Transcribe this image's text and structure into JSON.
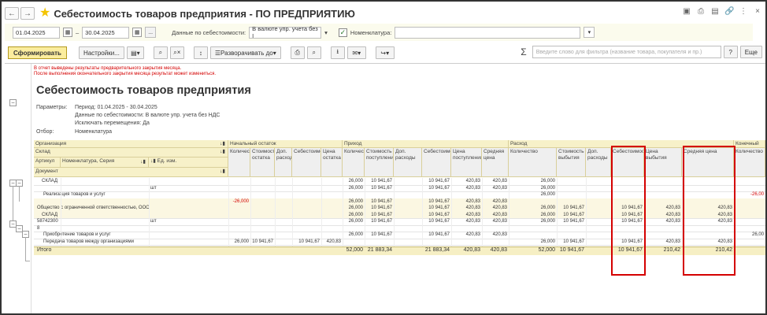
{
  "window": {
    "title": "Себестоимость товаров предприятия - ПО ПРЕДПРИЯТИЮ"
  },
  "params": {
    "date_from": "01.04.2025",
    "date_to": "30.04.2025",
    "dash": "–",
    "ellipsis": "...",
    "cost_data_label": "Данные по себестоимости:",
    "cost_data_value": "В валюте упр. учета без I",
    "nomenclature_label": "Номенклатура:",
    "nomenclature_value": ""
  },
  "toolbar": {
    "generate": "Сформировать",
    "settings": "Настройки...",
    "expand": "Разворачивать до",
    "search_placeholder": "Введите слово для фильтра (название товара, покупателя и пр.)",
    "help": "?",
    "more": "Еще"
  },
  "report": {
    "warning1": "В отчет выведены результаты предварительного закрытия месяца.",
    "warning2": "После выполнения окончательного закрытия месяца результат может измениться.",
    "title": "Себестоимость товаров предприятия",
    "params_label": "Параметры:",
    "period": "Период: 01.04.2025 - 30.04.2025",
    "cost_data": "Данные по себестоимости: В валюте упр. учета без НДС",
    "exclude": "Исключать перемещения: Да",
    "filter_label": "Отбор:",
    "filter_value": "Номенклатура"
  },
  "table": {
    "headers": {
      "org": "Организация",
      "warehouse": "Склад",
      "article": "Артикул",
      "nomenclature": "Номенклатура, Серия",
      "unit": "Ед. изм.",
      "document": "Документ",
      "opening": "Начальный остаток",
      "income": "Приход",
      "expense": "Расход",
      "closing": "Конечный о",
      "o_qty": "Количество",
      "o_cost": "Стоимость остатка",
      "o_add": "Доп. расходы",
      "o_self": "Себестоимость",
      "o_price": "Цена остатка",
      "i_qty": "Количество",
      "i_cost": "Стоимость поступления",
      "i_add": "Доп. расходы",
      "i_self": "Себестоимость",
      "i_price": "Цена поступления",
      "i_avg": "Средняя цена",
      "e_qty": "Количество",
      "e_cost": "Стоимость выбытия",
      "e_add": "Доп. расходы",
      "e_self": "Себестоимость",
      "e_price": "Цена выбытия",
      "e_avg": "Средняя цена",
      "c_qty": "Количество"
    },
    "rows": [
      {
        "label": "СКЛАД",
        "o_qty": "",
        "o_cost": "",
        "o_self": "",
        "o_price": "",
        "i_qty": "26,000",
        "i_cost": "10 941,67",
        "i_self": "10 941,67",
        "i_price": "420,83",
        "i_avg": "420,83",
        "e_qty": "26,000",
        "e_cost": "",
        "e_self": "",
        "e_price": "",
        "e_avg": "",
        "c": ""
      },
      {
        "label": "шт",
        "o_qty": "",
        "o_cost": "",
        "o_self": "",
        "o_price": "",
        "i_qty": "26,000",
        "i_cost": "10 941,67",
        "i_self": "10 941,67",
        "i_price": "420,83",
        "i_avg": "420,83",
        "e_qty": "26,000",
        "e_cost": "",
        "e_self": "",
        "e_price": "",
        "e_avg": "",
        "c": ""
      },
      {
        "label": "Реализация товаров и услуг",
        "o_qty": "",
        "o_cost": "",
        "o_self": "",
        "o_price": "",
        "i_qty": "",
        "i_cost": "",
        "i_self": "",
        "i_price": "",
        "i_avg": "",
        "e_qty": "26,000",
        "e_cost": "",
        "e_self": "",
        "e_price": "",
        "e_avg": "",
        "c": "-26,00"
      },
      {
        "label": "",
        "o_qty": "-26,000",
        "o_cost": "",
        "o_self": "",
        "o_price": "",
        "i_qty": "26,000",
        "i_cost": "10 941,67",
        "i_self": "10 941,67",
        "i_price": "420,83",
        "i_avg": "420,83",
        "e_qty": "",
        "e_cost": "",
        "e_self": "",
        "e_price": "",
        "e_avg": "",
        "c": ""
      },
      {
        "label": "Общество с ограниченной ответственностью, ООО",
        "o_qty": "",
        "o_cost": "",
        "o_self": "",
        "o_price": "",
        "i_qty": "26,000",
        "i_cost": "10 941,67",
        "i_self": "10 941,67",
        "i_price": "420,83",
        "i_avg": "420,83",
        "e_qty": "26,000",
        "e_cost": "10 941,67",
        "e_self": "10 941,67",
        "e_price": "420,83",
        "e_avg": "420,83",
        "c": ""
      },
      {
        "label": "СКЛАД",
        "o_qty": "",
        "o_cost": "",
        "o_self": "",
        "o_price": "",
        "i_qty": "26,000",
        "i_cost": "10 941,67",
        "i_self": "10 941,67",
        "i_price": "420,83",
        "i_avg": "420,83",
        "e_qty": "26,000",
        "e_cost": "10 941,67",
        "e_self": "10 941,67",
        "e_price": "420,83",
        "e_avg": "420,83",
        "c": ""
      },
      {
        "label": "58742300",
        "label2": "шт",
        "o_qty": "",
        "o_cost": "",
        "o_self": "",
        "o_price": "",
        "i_qty": "26,000",
        "i_cost": "10 941,67",
        "i_self": "10 941,67",
        "i_price": "420,83",
        "i_avg": "420,83",
        "e_qty": "26,000",
        "e_cost": "10 941,67",
        "e_self": "10 941,67",
        "e_price": "420,83",
        "e_avg": "420,83",
        "c": ""
      },
      {
        "label": "8",
        "o_qty": "",
        "o_cost": "",
        "o_self": "",
        "o_price": "",
        "i_qty": "",
        "i_cost": "",
        "i_self": "",
        "i_price": "",
        "i_avg": "",
        "e_qty": "",
        "e_cost": "",
        "e_self": "",
        "e_price": "",
        "e_avg": "",
        "c": ""
      },
      {
        "label": "Приобретение товаров и услуг",
        "o_qty": "",
        "o_cost": "",
        "o_self": "",
        "o_price": "",
        "i_qty": "26,000",
        "i_cost": "10 941,67",
        "i_self": "10 941,67",
        "i_price": "420,83",
        "i_avg": "420,83",
        "e_qty": "",
        "e_cost": "",
        "e_self": "",
        "e_price": "",
        "e_avg": "",
        "c": "26,00"
      },
      {
        "label": "Передача товаров между организациями",
        "o_qty": "26,000",
        "o_cost": "10 941,67",
        "o_self": "10 941,67",
        "o_price": "420,83",
        "i_qty": "",
        "i_cost": "",
        "i_self": "",
        "i_price": "",
        "i_avg": "",
        "e_qty": "26,000",
        "e_cost": "10 941,67",
        "e_self": "10 941,67",
        "e_price": "420,83",
        "e_avg": "420,83",
        "c": ""
      }
    ],
    "total": {
      "label": "Итого",
      "i_qty": "52,000",
      "i_cost": "21 883,34",
      "i_self": "21 883,34",
      "i_price": "420,83",
      "i_avg": "420,83",
      "e_qty": "52,000",
      "e_cost": "10 941,67",
      "e_self": "10 941,67",
      "e_price": "210,42",
      "e_avg": "210,42"
    }
  }
}
